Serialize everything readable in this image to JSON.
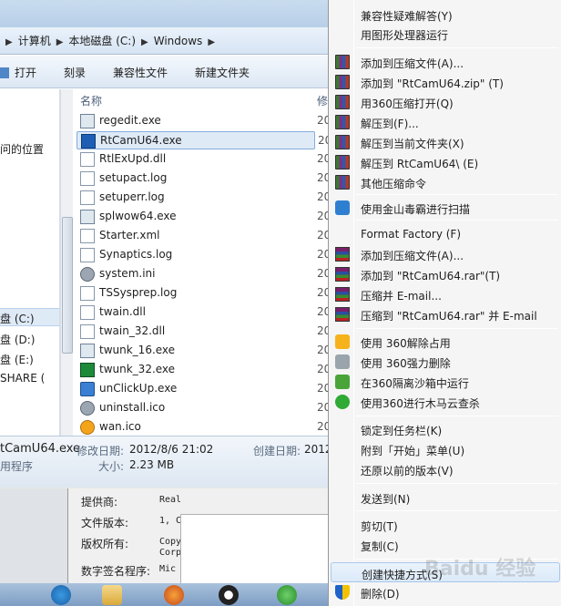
{
  "explorer": {
    "breadcrumb": [
      "计算机",
      "本地磁盘 (C:)",
      "Windows"
    ],
    "toolbar": {
      "open": "打开",
      "burn": "刻录",
      "compat_files": "兼容性文件",
      "new_folder": "新建文件夹"
    },
    "nav": {
      "recent_places": "问的位置",
      "drive_c": "盘 (C:)",
      "drive_d": "盘 (D:)",
      "drive_e": "盘 (E:)",
      "share": "SHARE ("
    },
    "column_name": "名称",
    "column_date_partial": "修",
    "files": [
      {
        "name": "regedit.exe",
        "date": "20",
        "icon": "regedit-icon"
      },
      {
        "name": "RtCamU64.exe",
        "date": "20",
        "icon": "rtcam-icon",
        "selected": true
      },
      {
        "name": "RtlExUpd.dll",
        "date": "20",
        "icon": "dll-icon"
      },
      {
        "name": "setupact.log",
        "date": "20",
        "icon": "log-icon"
      },
      {
        "name": "setuperr.log",
        "date": "20",
        "icon": "log-icon"
      },
      {
        "name": "splwow64.exe",
        "date": "20",
        "icon": "exe-icon"
      },
      {
        "name": "Starter.xml",
        "date": "20",
        "icon": "xml-icon"
      },
      {
        "name": "Synaptics.log",
        "date": "20",
        "icon": "log-icon"
      },
      {
        "name": "system.ini",
        "date": "20",
        "icon": "ini-icon"
      },
      {
        "name": "TSSysprep.log",
        "date": "20",
        "icon": "log-icon"
      },
      {
        "name": "twain.dll",
        "date": "20",
        "icon": "dll-icon"
      },
      {
        "name": "twain_32.dll",
        "date": "20",
        "icon": "dll-icon"
      },
      {
        "name": "twunk_16.exe",
        "date": "20",
        "icon": "exe-icon"
      },
      {
        "name": "twunk_32.exe",
        "date": "20",
        "icon": "twunk32-icon"
      },
      {
        "name": "unClickUp.exe",
        "date": "20",
        "icon": "unclickup-icon"
      },
      {
        "name": "uninstall.ico",
        "date": "20",
        "icon": "uninstall-icon"
      },
      {
        "name": "wan.ico",
        "date": "20",
        "icon": "wan-icon"
      }
    ],
    "details": {
      "filename": "tCamU64.exe",
      "modified_label": "修改日期:",
      "modified_value": "2012/8/6 21:02",
      "created_label": "创建日期:",
      "created_value": "2012",
      "type": "用程序",
      "size_label": "大小:",
      "size_value": "2.23 MB"
    }
  },
  "properties": {
    "rows": [
      {
        "label": "提供商:",
        "value": "Real"
      },
      {
        "label": "文件版本:",
        "value": "1, C"
      },
      {
        "label": "版权所有:",
        "value": "Copy"
      },
      {
        "label": "",
        "value": "Corp"
      },
      {
        "label": "数字签名程序:",
        "value": "Mic"
      }
    ]
  },
  "context_menu": {
    "items": [
      {
        "label": "兼容性疑难解答(Y)",
        "icon": ""
      },
      {
        "label": "用图形处理器运行",
        "icon": ""
      },
      {
        "sep": true
      },
      {
        "label": "添加到压缩文件(A)...",
        "icon": "archive-books-icon"
      },
      {
        "label": "添加到 \"RtCamU64.zip\" (T)",
        "icon": "archive-books-icon"
      },
      {
        "label": "用360压缩打开(Q)",
        "icon": "archive-books-icon"
      },
      {
        "label": "解压到(F)...",
        "icon": "archive-books-icon"
      },
      {
        "label": "解压到当前文件夹(X)",
        "icon": "archive-books-icon"
      },
      {
        "label": "解压到 RtCamU64\\ (E)",
        "icon": "archive-books-icon"
      },
      {
        "label": "其他压缩命令",
        "icon": "archive-books-icon"
      },
      {
        "sep": true
      },
      {
        "label": "使用金山毒霸进行扫描",
        "icon": "kingsoft-icon"
      },
      {
        "sep": true
      },
      {
        "label": "Format Factory (F)",
        "icon": ""
      },
      {
        "label": "添加到压缩文件(A)...",
        "icon": "winrar-icon"
      },
      {
        "label": "添加到 \"RtCamU64.rar\"(T)",
        "icon": "winrar-icon"
      },
      {
        "label": "压缩并 E-mail...",
        "icon": "winrar-icon"
      },
      {
        "label": "压缩到 \"RtCamU64.rar\" 并 E-mail",
        "icon": "winrar-icon"
      },
      {
        "sep": true
      },
      {
        "label": "使用 360解除占用",
        "icon": "unlock-360-icon"
      },
      {
        "label": "使用 360强力删除",
        "icon": "shred-360-icon"
      },
      {
        "label": "在360隔离沙箱中运行",
        "icon": "sandbox-360-icon"
      },
      {
        "label": "使用360进行木马云查杀",
        "icon": "trojan-scan-360-icon"
      },
      {
        "sep": true
      },
      {
        "label": "锁定到任务栏(K)",
        "icon": ""
      },
      {
        "label": "附到「开始」菜单(U)",
        "icon": ""
      },
      {
        "label": "还原以前的版本(V)",
        "icon": ""
      },
      {
        "sep": true
      },
      {
        "label": "发送到(N)",
        "icon": ""
      },
      {
        "sep": true
      },
      {
        "label": "剪切(T)",
        "icon": ""
      },
      {
        "label": "复制(C)",
        "icon": ""
      },
      {
        "sep": true
      },
      {
        "label": "创建快捷方式(S)",
        "icon": "",
        "highlighted": true
      },
      {
        "label": "删除(D)",
        "icon": "uac-shield-icon"
      }
    ]
  },
  "watermark": "Baidu 经验"
}
